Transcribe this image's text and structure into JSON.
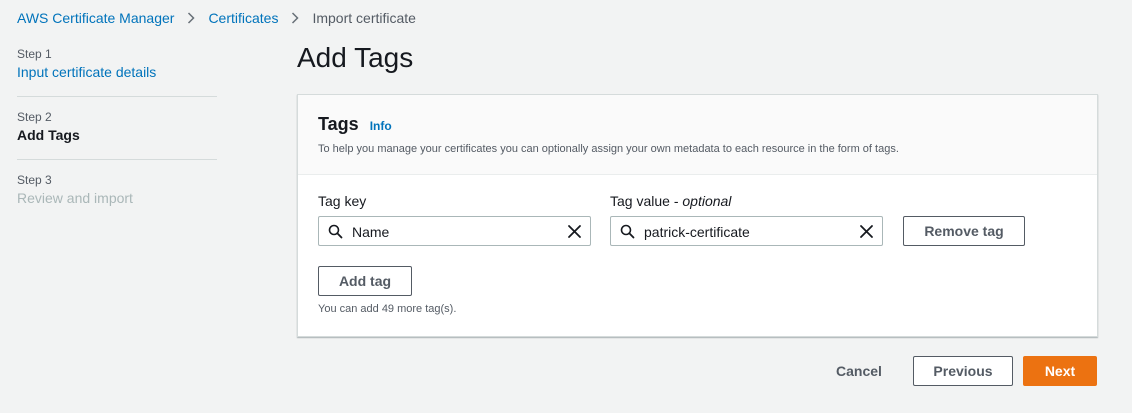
{
  "breadcrumb": {
    "items": [
      "AWS Certificate Manager",
      "Certificates"
    ],
    "current": "Import certificate"
  },
  "steps": [
    {
      "number": "Step 1",
      "title": "Input certificate details",
      "state": "link"
    },
    {
      "number": "Step 2",
      "title": "Add Tags",
      "state": "active"
    },
    {
      "number": "Step 3",
      "title": "Review and import",
      "state": "disabled"
    }
  ],
  "page": {
    "title": "Add Tags"
  },
  "tags_panel": {
    "title": "Tags",
    "info": "Info",
    "description": "To help you manage your certificates you can optionally assign your own metadata to each resource in the form of tags.",
    "key_label": "Tag key",
    "value_label_main": "Tag value - ",
    "value_label_optional": "optional",
    "key_value": "Name",
    "value_value": "patrick-certificate",
    "remove_label": "Remove tag",
    "add_label": "Add tag",
    "help": "You can add 49 more tag(s)."
  },
  "footer": {
    "cancel": "Cancel",
    "previous": "Previous",
    "next": "Next"
  },
  "colors": {
    "link": "#0073bb",
    "primary": "#ec7211",
    "background": "#f2f3f3"
  }
}
